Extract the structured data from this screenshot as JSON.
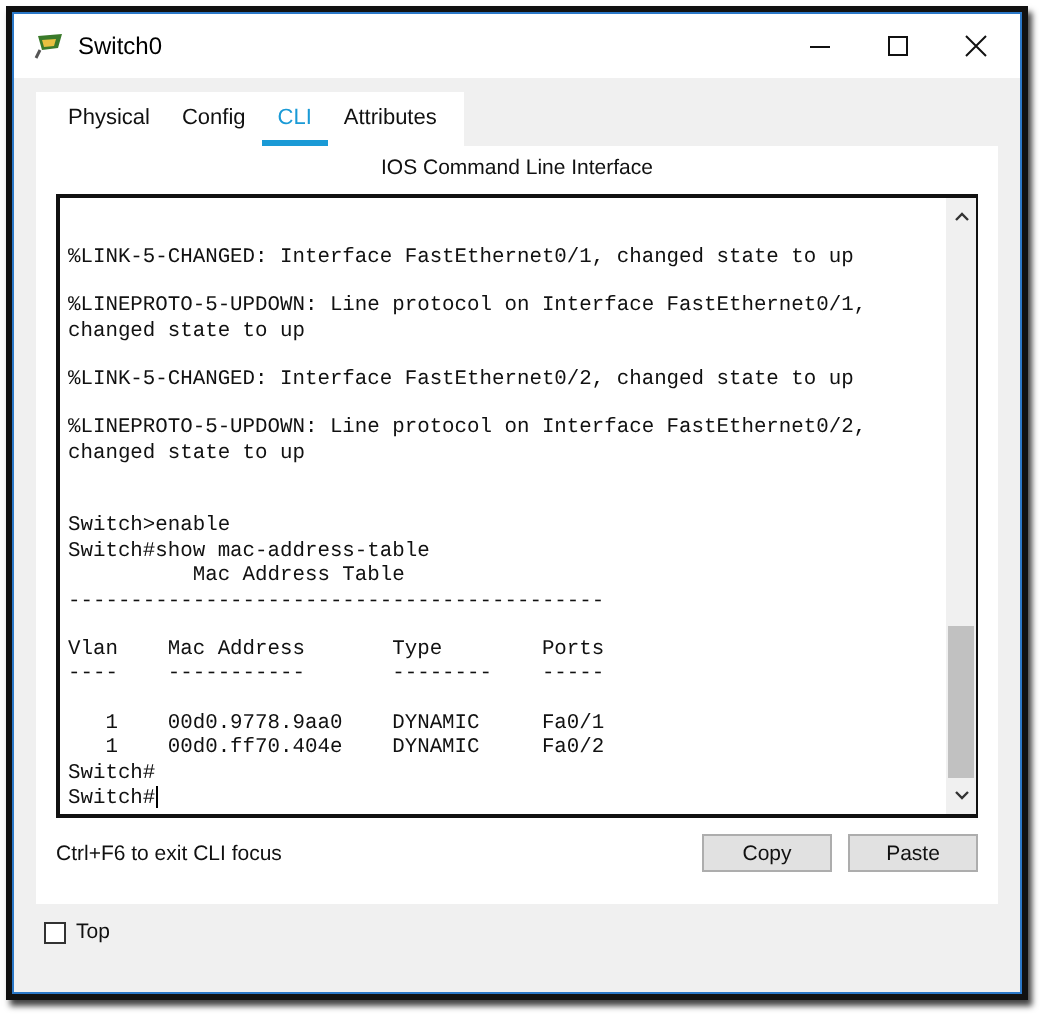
{
  "window": {
    "title": "Switch0"
  },
  "tabs": [
    {
      "label": "Physical",
      "selected": false
    },
    {
      "label": "Config",
      "selected": false
    },
    {
      "label": "CLI",
      "selected": true
    },
    {
      "label": "Attributes",
      "selected": false
    }
  ],
  "panel_title": "IOS Command Line Interface",
  "console": [
    {
      "kind": "text",
      "text": "%LINK-5-CHANGED: Interface FastEthernet0/1, changed state to up"
    },
    {
      "kind": "blank"
    },
    {
      "kind": "text",
      "text": "%LINEPROTO-5-UPDOWN: Line protocol on Interface FastEthernet0/1,"
    },
    {
      "kind": "text",
      "text": "changed state to up"
    },
    {
      "kind": "blank"
    },
    {
      "kind": "text",
      "text": "%LINK-5-CHANGED: Interface FastEthernet0/2, changed state to up"
    },
    {
      "kind": "blank"
    },
    {
      "kind": "text",
      "text": "%LINEPROTO-5-UPDOWN: Line protocol on Interface FastEthernet0/2,"
    },
    {
      "kind": "text",
      "text": "changed state to up"
    },
    {
      "kind": "blank"
    },
    {
      "kind": "blank"
    },
    {
      "kind": "text",
      "text": "Switch>enable"
    },
    {
      "kind": "text",
      "text": "Switch#show mac-address-table"
    },
    {
      "kind": "text",
      "text": "          Mac Address Table"
    },
    {
      "kind": "text",
      "text": "-------------------------------------------"
    },
    {
      "kind": "blank"
    },
    {
      "kind": "text",
      "text": "Vlan    Mac Address       Type        Ports"
    },
    {
      "kind": "text",
      "text": "----    -----------       --------    -----"
    },
    {
      "kind": "blank"
    },
    {
      "kind": "text",
      "text": "   1    00d0.9778.9aa0    DYNAMIC     Fa0/1"
    },
    {
      "kind": "text",
      "text": "   1    00d0.ff70.404e    DYNAMIC     Fa0/2"
    },
    {
      "kind": "text",
      "text": "Switch#"
    },
    {
      "kind": "prompt",
      "text": "Switch#"
    }
  ],
  "hint": "Ctrl+F6 to exit CLI focus",
  "buttons": [
    "Copy",
    "Paste"
  ],
  "top_checkbox": {
    "label": "Top",
    "checked": false
  }
}
